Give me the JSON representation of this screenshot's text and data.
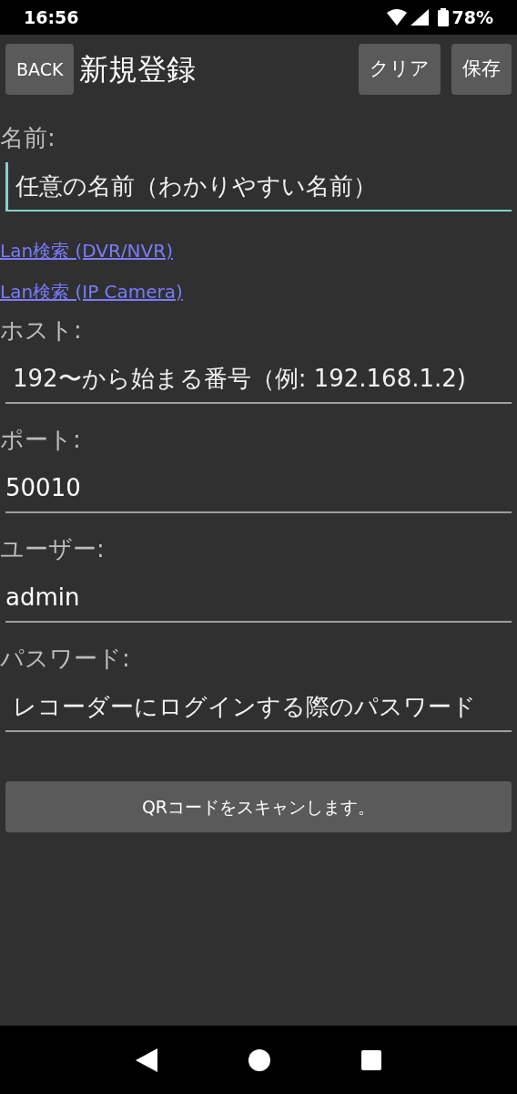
{
  "status_bar": {
    "time": "16:56",
    "battery": "78%"
  },
  "toolbar": {
    "back": "BACK",
    "title": "新規登録",
    "buttons": [
      "クリア",
      "保存"
    ]
  },
  "fields": [
    {
      "label": "名前:",
      "placeholder": "任意の名前（わかりやすい名前）",
      "focused": true
    },
    {
      "kind": "links",
      "links": [
        "Lan検索 (DVR/NVR)",
        "Lan検索 (IP Camera)"
      ]
    },
    {
      "label": "ホスト:",
      "placeholder": "192〜から始まる番号（例: 192.168.1.2)",
      "focused": false
    },
    {
      "label": "ポート:",
      "value": "50010",
      "focused": false
    },
    {
      "label": "ユーザー:",
      "value": "admin",
      "focused": false
    },
    {
      "label": "パスワード:",
      "placeholder": "レコーダーにログインする際のパスワード",
      "focused": false
    }
  ],
  "scan_button": "QRコードをスキャンします。"
}
